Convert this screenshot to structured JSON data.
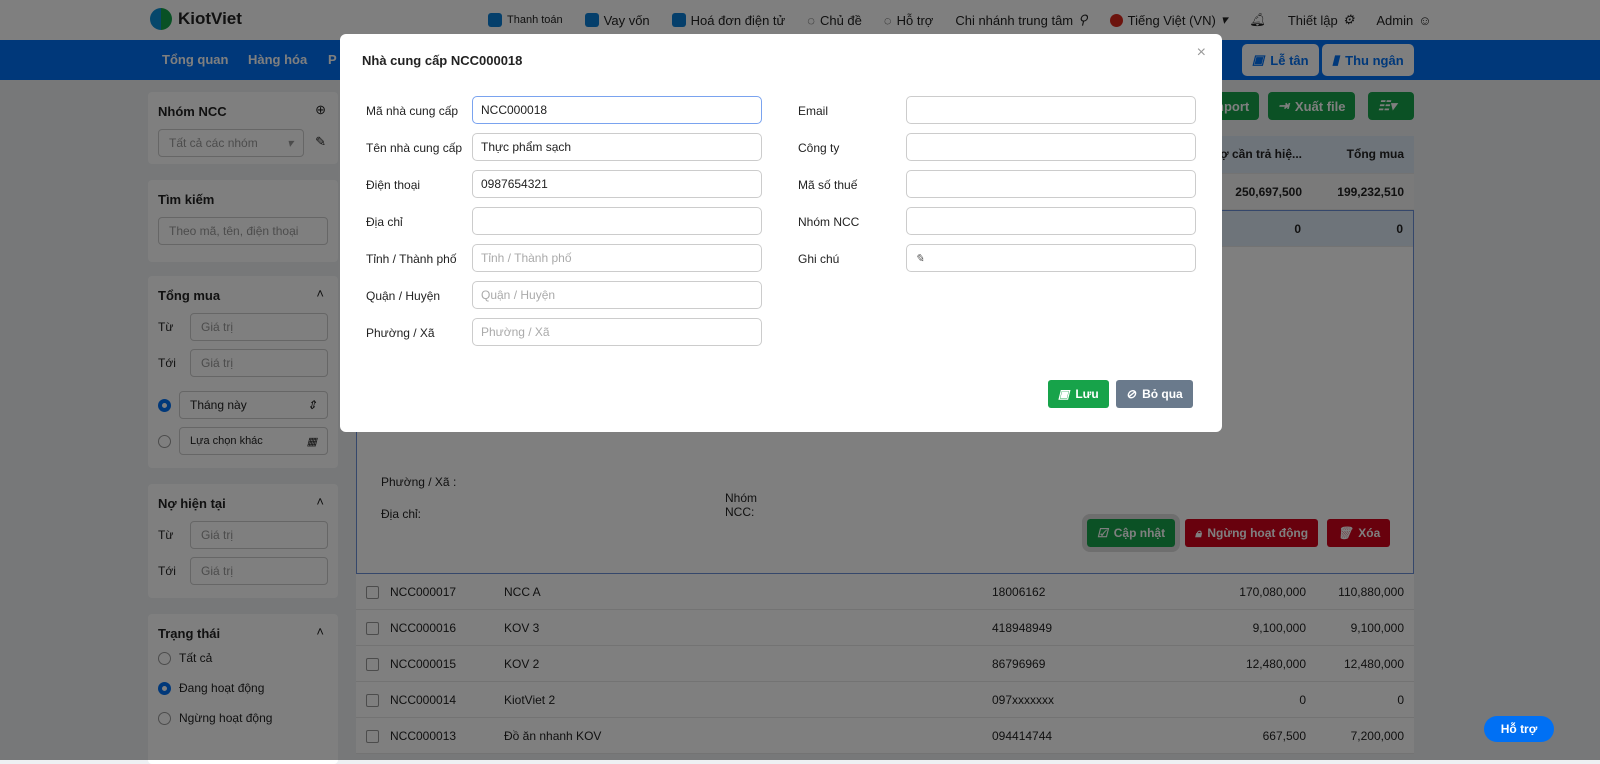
{
  "app": {
    "logo": "KiotViet"
  },
  "topbar": {
    "links": [
      "Thanh toán",
      "Vay vốn",
      "Hoá đơn điện tử",
      "Chủ đề",
      "Hỗ trợ",
      "Chi nhánh trung tâm",
      "Tiếng Việt (VN)",
      "Thiết lập",
      "Admin"
    ]
  },
  "nav": {
    "items": [
      "Tổng quan",
      "Hàng hóa",
      "P"
    ],
    "buttons": [
      "Lễ tân",
      "Thu ngân"
    ]
  },
  "sidebar": {
    "group": {
      "title": "Nhóm NCC",
      "select": "Tất cả các nhóm"
    },
    "search": {
      "title": "Tìm kiếm",
      "placeholder": "Theo mã, tên, điện thoại"
    },
    "total": {
      "title": "Tổng mua",
      "from": "Từ",
      "to": "Tới",
      "placeholder": "Giá trị",
      "period": "Tháng này",
      "other": "Lựa chọn khác"
    },
    "debt": {
      "title": "Nợ hiện tại",
      "from": "Từ",
      "to": "Tới",
      "placeholder": "Giá trị"
    },
    "status": {
      "title": "Trạng thái",
      "options": [
        "Tất cả",
        "Đang hoạt động",
        "Ngừng hoạt động"
      ]
    }
  },
  "toolbar": {
    "import": "nport",
    "export": "Xuất file"
  },
  "table": {
    "headers": {
      "debt": "Nợ cần trả hiệ...",
      "total": "Tổng mua"
    },
    "summary": {
      "debt": "250,697,500",
      "total": "199,232,510"
    },
    "selected": {
      "debt": "0",
      "total": "0"
    },
    "detail": {
      "ward": "Phường / Xã :",
      "address": "Địa chỉ:",
      "group": "Nhóm NCC:",
      "update": "Cập nhật",
      "deactivate": "Ngừng hoạt động",
      "delete": "Xóa"
    },
    "rows": [
      {
        "code": "NCC000017",
        "name": "NCC A",
        "phone": "18006162",
        "debt": "170,080,000",
        "total": "110,880,000"
      },
      {
        "code": "NCC000016",
        "name": "KOV 3",
        "phone": "418948949",
        "debt": "9,100,000",
        "total": "9,100,000"
      },
      {
        "code": "NCC000015",
        "name": "KOV 2",
        "phone": "86796969",
        "debt": "12,480,000",
        "total": "12,480,000"
      },
      {
        "code": "NCC000014",
        "name": "KiotViet 2",
        "phone": "097xxxxxxx",
        "debt": "0",
        "total": "0"
      },
      {
        "code": "NCC000013",
        "name": "Đồ ăn nhanh KOV",
        "phone": "094414744",
        "debt": "667,500",
        "total": "7,200,000"
      }
    ]
  },
  "modal": {
    "title": "Nhà cung cấp NCC000018",
    "close": "×",
    "left": [
      {
        "label": "Mã nhà cung cấp",
        "value": "NCC000018"
      },
      {
        "label": "Tên nhà cung cấp",
        "value": "Thực phẩm sạch"
      },
      {
        "label": "Điện thoại",
        "value": "0987654321"
      },
      {
        "label": "Địa chỉ",
        "value": ""
      },
      {
        "label": "Tỉnh / Thành phố",
        "placeholder": "Tỉnh / Thành phố"
      },
      {
        "label": "Quận / Huyện",
        "placeholder": "Quận / Huyện"
      },
      {
        "label": "Phường / Xã",
        "placeholder": "Phường / Xã"
      }
    ],
    "right": [
      {
        "label": "Email",
        "value": ""
      },
      {
        "label": "Công ty",
        "value": ""
      },
      {
        "label": "Mã số thuế",
        "value": ""
      },
      {
        "label": "Nhóm NCC",
        "value": ""
      },
      {
        "label": "Ghi chú",
        "value": ""
      }
    ],
    "save": "Lưu",
    "skip": "Bỏ qua"
  },
  "help": "Hỗ trợ"
}
